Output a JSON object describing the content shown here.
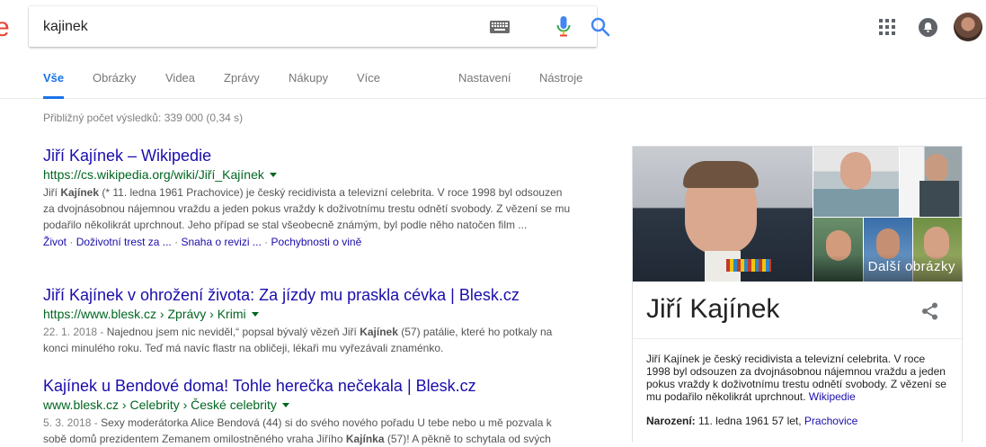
{
  "header": {
    "logo_fragment": "e",
    "search": {
      "value": "kajinek"
    }
  },
  "tabs": [
    {
      "label": "Vše",
      "active": true
    },
    {
      "label": "Obrázky"
    },
    {
      "label": "Videa"
    },
    {
      "label": "Zprávy"
    },
    {
      "label": "Nákupy"
    },
    {
      "label": "Více"
    },
    {
      "label": "Nastavení"
    },
    {
      "label": "Nástroje"
    }
  ],
  "stats": "Přibližný počet výsledků: 339 000 (0,34 s)",
  "results": [
    {
      "title": "Jiří Kajínek – Wikipedie",
      "url": "https://cs.wikipedia.org/wiki/Jiří_Kajínek",
      "snippet_before": "Jiří ",
      "snippet_bold": "Kajínek",
      "snippet_after": " (* 11. ledna 1961 Prachovice) je český recidivista a televizní celebrita. V roce 1998 byl odsouzen za dvojnásobnou nájemnou vraždu a jeden pokus vraždy k doživotnímu trestu odnětí svobody. Z vězení se mu podařilo několikrát uprchnout. Jeho případ se stal všeobecně známým, byl podle něho natočen film ...",
      "sitelinks": [
        "Život",
        "Doživotní trest za ...",
        "Snaha o revizi ...",
        "Pochybnosti o vině"
      ],
      "sitelink_sep": "·"
    },
    {
      "title": "Jiří Kajínek v ohrožení života: Za jízdy mu praskla cévka | Blesk.cz",
      "url": "https://www.blesk.cz › Zprávy › Krimi",
      "date": "22. 1. 2018",
      "date_sep": " - ",
      "snippet_before": "Najednou jsem nic neviděl,“ popsal bývalý vězeň Jiří ",
      "snippet_bold": "Kajínek",
      "snippet_after": " (57) patálie, které ho potkaly na konci minulého roku. Teď má navíc flastr na obličeji, lékaři mu vyřezávali znaménko."
    },
    {
      "title": "Kajínek u Bendové doma! Tohle herečka nečekala | Blesk.cz",
      "url": "www.blesk.cz › Celebrity › České celebrity",
      "date": "5. 3. 2018",
      "date_sep": " - ",
      "snippet_before": "Sexy moderátorka Alice Bendová (44) si do svého nového pořadu U tebe nebo u mě pozvala k sobě domů prezidentem Zemanem omilostněného vraha Jiřího ",
      "snippet_bold": "Kajínka",
      "snippet_after": " (57)! A pěkně to schytala od svých"
    }
  ],
  "knowledge_panel": {
    "title": "Jiří Kajínek",
    "more_images": "Další obrázky",
    "description": "Jiří Kajínek je český recidivista a televizní celebrita. V roce 1998 byl odsouzen za dvojnásobnou nájemnou vraždu a jeden pokus vraždy k doživotnímu trestu odnětí svobody. Z vězení se mu podařilo několikrát uprchnout.",
    "description_link": "Wikipedie",
    "born_label": "Narození:",
    "born_value": "11. ledna 1961 57 let,",
    "born_place": "Prachovice"
  },
  "colors": {
    "accent": "#1a73e8",
    "link": "#1a0dab",
    "url": "#006621",
    "snippet": "#545454"
  }
}
